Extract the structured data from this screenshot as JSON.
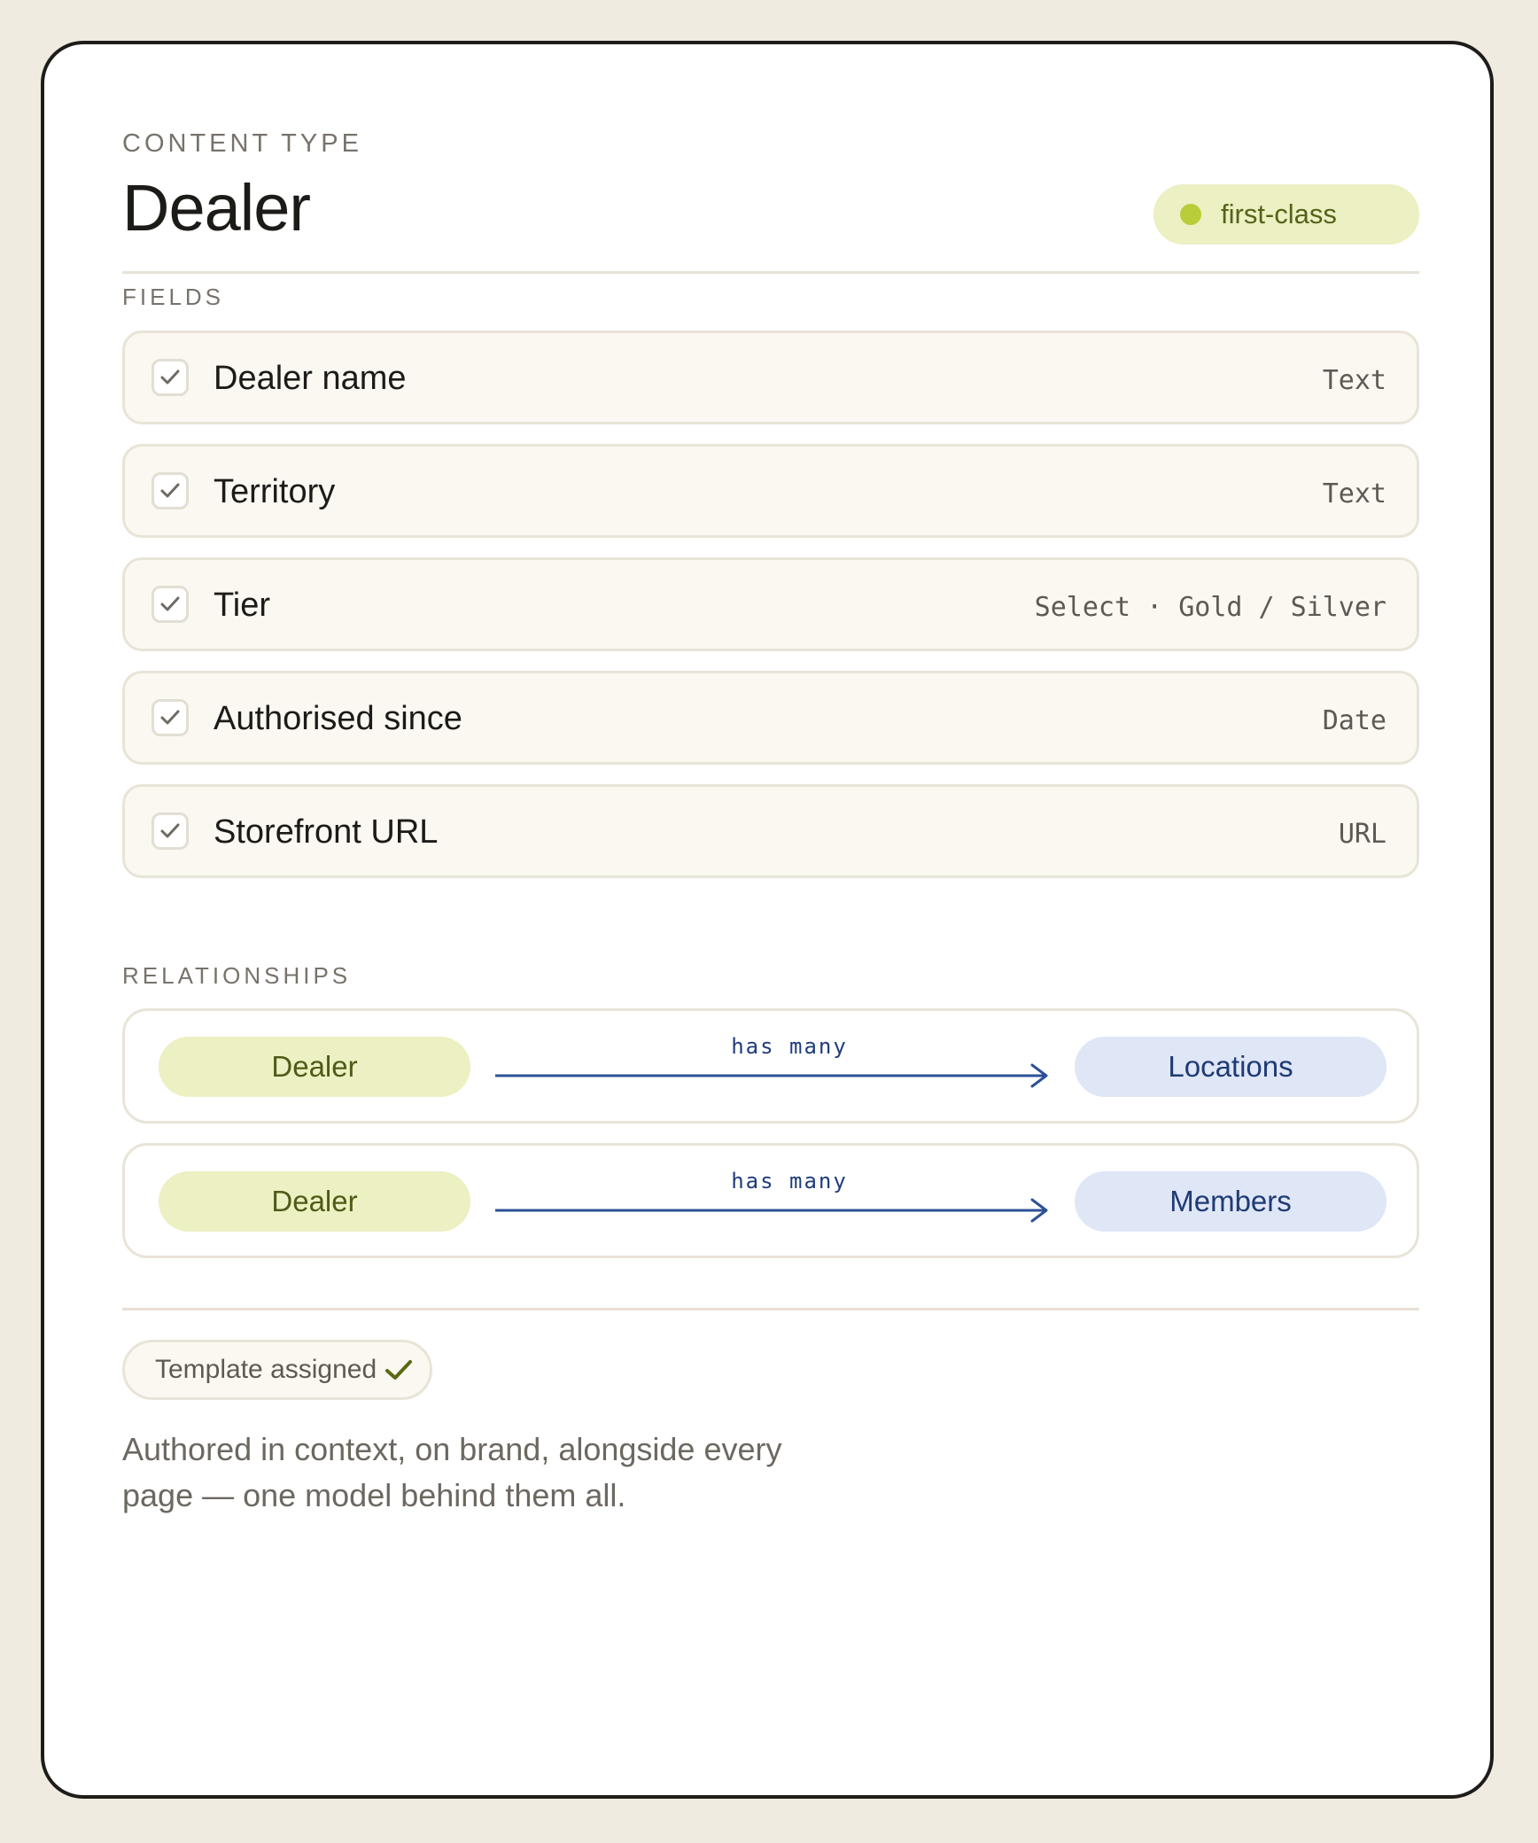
{
  "header": {
    "eyebrow": "CONTENT TYPE",
    "title": "Dealer",
    "badge": {
      "label": "first-class",
      "icon": "status-dot-icon"
    }
  },
  "fields_section": {
    "label": "FIELDS",
    "items": [
      {
        "name": "Dealer name",
        "type": "Text",
        "checked": true
      },
      {
        "name": "Territory",
        "type": "Text",
        "checked": true
      },
      {
        "name": "Tier",
        "type": "Select · Gold / Silver",
        "checked": true
      },
      {
        "name": "Authorised since",
        "type": "Date",
        "checked": true
      },
      {
        "name": "Storefront URL",
        "type": "URL",
        "checked": true
      }
    ]
  },
  "relationships_section": {
    "label": "RELATIONSHIPS",
    "items": [
      {
        "source": "Dealer",
        "relation": "has many",
        "target": "Locations"
      },
      {
        "source": "Dealer",
        "relation": "has many",
        "target": "Members"
      }
    ]
  },
  "footer": {
    "status": {
      "label": "Template assigned",
      "icon": "checkmark-icon"
    },
    "caption": "Authored in context, on brand, alongside every page — one model behind them all."
  },
  "colors": {
    "background": "#efebe0",
    "accent_green": "#b9cc3a",
    "accent_blue": "#1f3d7a"
  }
}
